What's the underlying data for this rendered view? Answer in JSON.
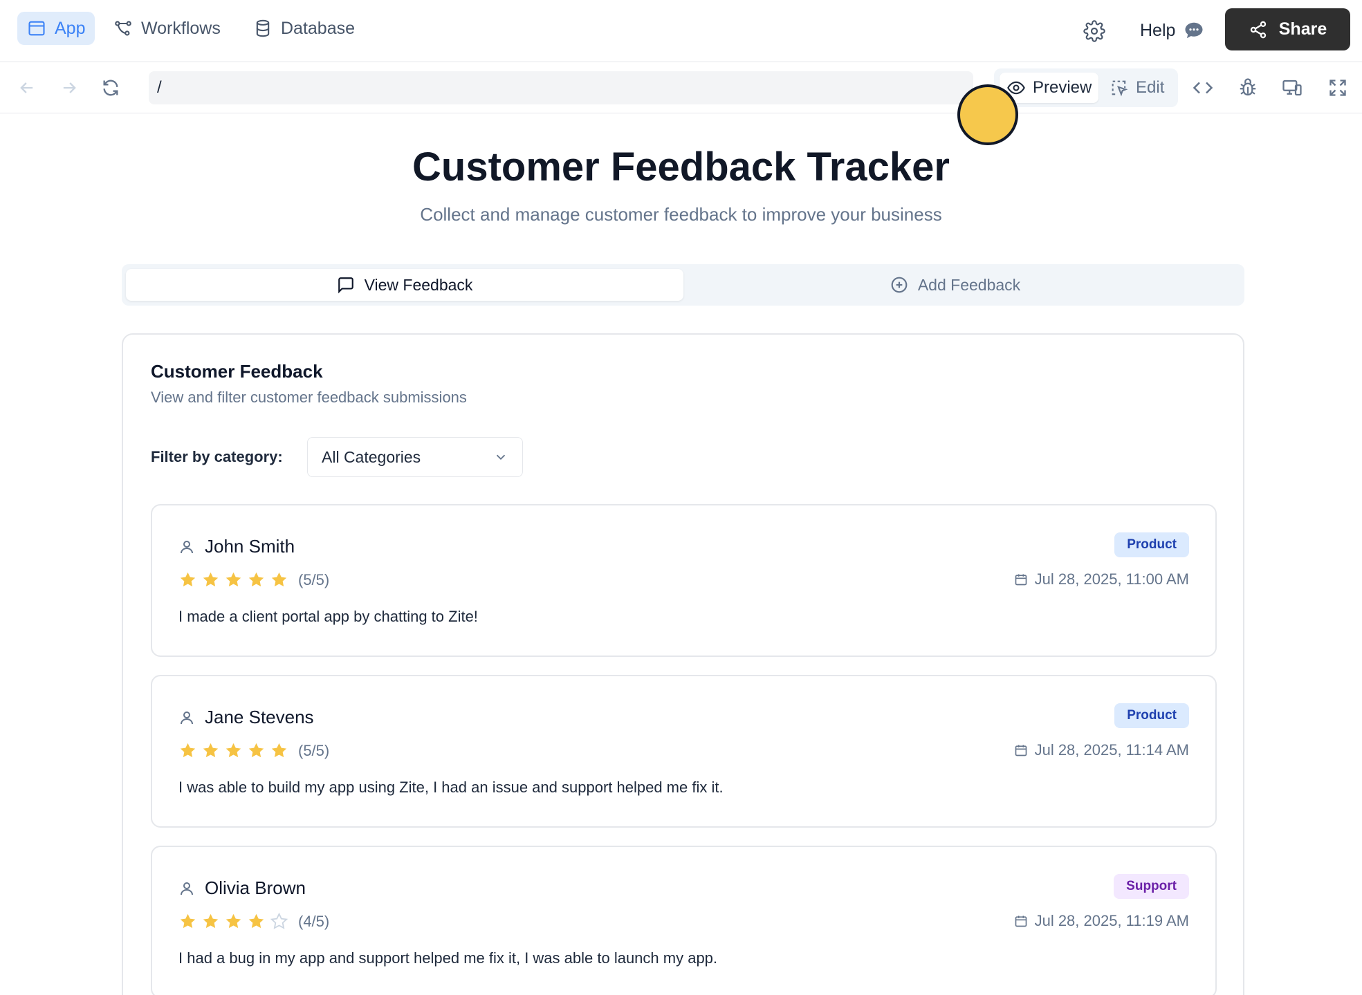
{
  "nav": {
    "tabs": [
      {
        "label": "App",
        "icon": "app-window-icon"
      },
      {
        "label": "Workflows",
        "icon": "workflow-icon"
      },
      {
        "label": "Database",
        "icon": "database-icon"
      }
    ],
    "help_label": "Help",
    "share_label": "Share"
  },
  "toolbar": {
    "url": "/",
    "preview_label": "Preview",
    "edit_label": "Edit"
  },
  "page": {
    "title": "Customer Feedback Tracker",
    "subtitle": "Collect and manage customer feedback to improve your business"
  },
  "tabs": {
    "view_label": "View Feedback",
    "add_label": "Add Feedback"
  },
  "panel": {
    "title": "Customer Feedback",
    "description": "View and filter customer feedback submissions",
    "filter_label": "Filter by category:",
    "filter_value": "All Categories"
  },
  "feedback": [
    {
      "name": "John Smith",
      "rating": 5,
      "rating_text": "(5/5)",
      "category": "Product",
      "date": "Jul 28, 2025, 11:00 AM",
      "comment": "I made a client portal app by chatting to Zite!"
    },
    {
      "name": "Jane Stevens",
      "rating": 5,
      "rating_text": "(5/5)",
      "category": "Product",
      "date": "Jul 28, 2025, 11:14 AM",
      "comment": "I was able to build my app using Zite, I had an issue and support helped me fix it."
    },
    {
      "name": "Olivia Brown",
      "rating": 4,
      "rating_text": "(4/5)",
      "category": "Support",
      "date": "Jul 28, 2025, 11:19 AM",
      "comment": "I had a bug in my app and support helped me fix it, I was able to launch my app."
    }
  ],
  "colors": {
    "accent": "#3b82f6",
    "star_filled": "#f6c343",
    "star_empty": "#cbd5e1",
    "share_button": "#2f2f2f",
    "cursor": "#f6c84c"
  }
}
